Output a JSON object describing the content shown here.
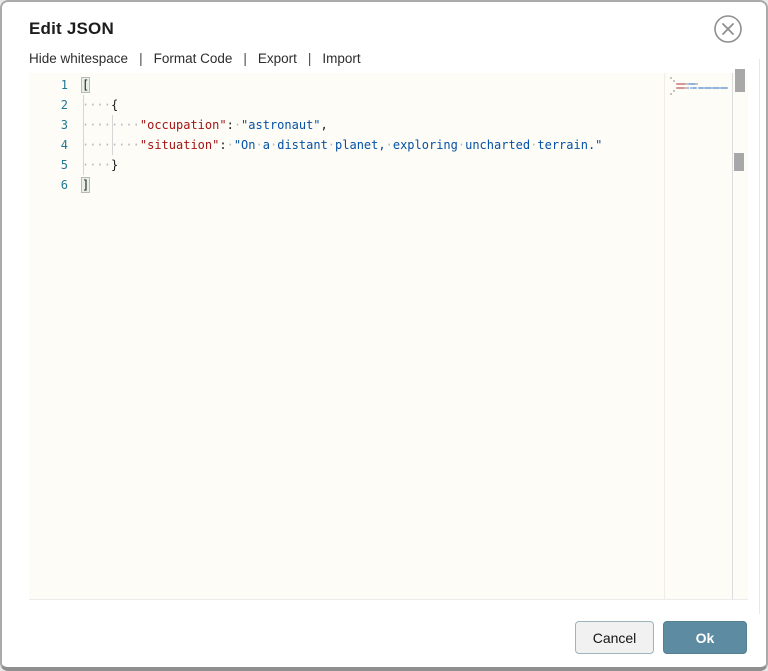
{
  "dialog": {
    "title": "Edit JSON"
  },
  "toolbar": {
    "separator": "|",
    "items": [
      {
        "label": "Hide whitespace"
      },
      {
        "label": "Format Code"
      },
      {
        "label": "Export"
      },
      {
        "label": "Import"
      }
    ]
  },
  "editor": {
    "language": "json",
    "lines": [
      {
        "num": "1",
        "tokens": [
          {
            "t": "[",
            "c": "punct",
            "match": true
          }
        ]
      },
      {
        "num": "2",
        "tokens": [
          {
            "t": "    ",
            "c": "ws"
          },
          {
            "t": "{",
            "c": "punct"
          }
        ]
      },
      {
        "num": "3",
        "tokens": [
          {
            "t": "        ",
            "c": "ws"
          },
          {
            "t": "\"occupation\"",
            "c": "key"
          },
          {
            "t": ":",
            "c": "punct"
          },
          {
            "t": " ",
            "c": "ws"
          },
          {
            "t": "\"astronaut\"",
            "c": "str"
          },
          {
            "t": ",",
            "c": "punct"
          }
        ]
      },
      {
        "num": "4",
        "tokens": [
          {
            "t": "        ",
            "c": "ws"
          },
          {
            "t": "\"situation\"",
            "c": "key"
          },
          {
            "t": ":",
            "c": "punct"
          },
          {
            "t": " ",
            "c": "ws"
          },
          {
            "t": "\"On a distant planet, exploring uncharted terrain.\"",
            "c": "str"
          }
        ]
      },
      {
        "num": "5",
        "tokens": [
          {
            "t": "    ",
            "c": "ws"
          },
          {
            "t": "}",
            "c": "punct"
          }
        ]
      },
      {
        "num": "6",
        "tokens": [
          {
            "t": "]",
            "c": "punct",
            "match": true
          }
        ]
      }
    ],
    "colors": {
      "line_number": "#237893",
      "key": "#a31515",
      "string": "#0451a5",
      "punctuation": "#1b1b1b",
      "whitespace_dot": "#b9b9b9"
    }
  },
  "footer": {
    "cancel_label": "Cancel",
    "ok_label": "Ok",
    "ok_color": "#5d8ba1"
  }
}
